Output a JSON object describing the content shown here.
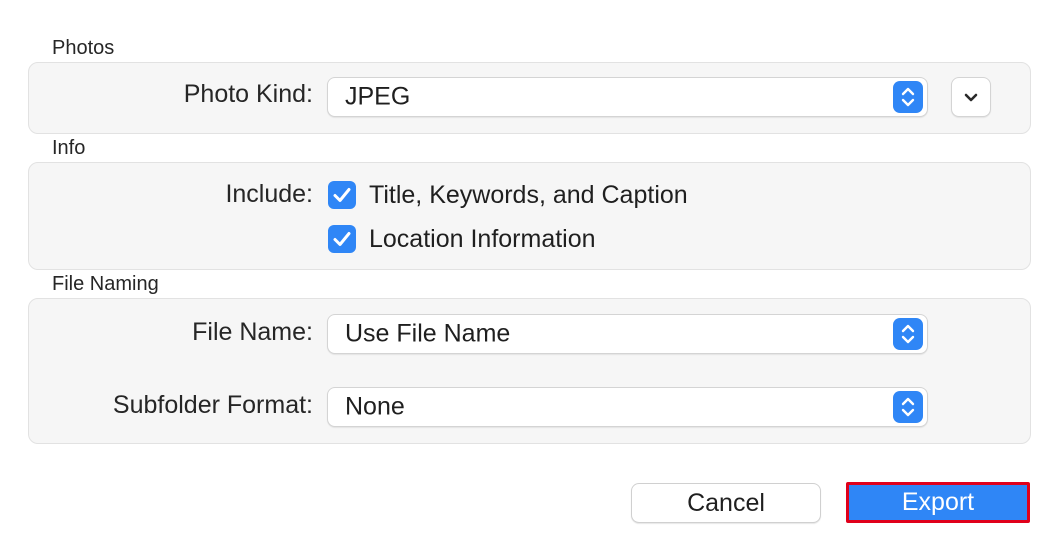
{
  "sections": {
    "photos": {
      "title": "Photos",
      "photo_kind_label": "Photo Kind:",
      "photo_kind_value": "JPEG"
    },
    "info": {
      "title": "Info",
      "include_label": "Include:",
      "options": [
        {
          "label": "Title, Keywords, and Caption",
          "checked": true
        },
        {
          "label": "Location Information",
          "checked": true
        }
      ]
    },
    "file_naming": {
      "title": "File Naming",
      "file_name_label": "File Name:",
      "file_name_value": "Use File Name",
      "subfolder_label": "Subfolder Format:",
      "subfolder_value": "None"
    }
  },
  "buttons": {
    "cancel": "Cancel",
    "export": "Export"
  },
  "icons": {
    "popup_stepper": "up-down-chevron-icon",
    "disclosure": "chevron-down-icon",
    "checkbox": "checkmark-icon"
  },
  "colors": {
    "accent": "#2f86f6",
    "highlight_border": "#e0001b",
    "group_background": "#f6f6f6"
  }
}
